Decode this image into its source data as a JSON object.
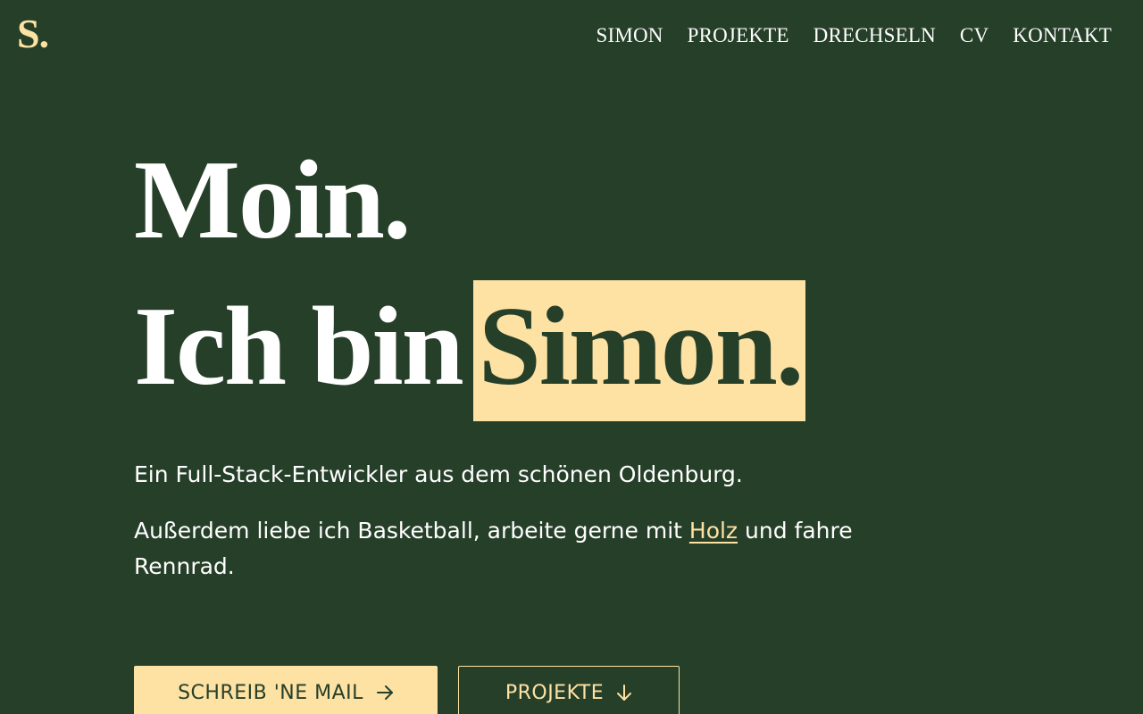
{
  "logo": "S.",
  "nav": {
    "items": [
      "SIMON",
      "PROJEKTE",
      "DRECHSELN",
      "CV",
      "KONTAKT"
    ]
  },
  "hero": {
    "greeting": "Moin.",
    "intro_prefix": "Ich bin",
    "name": "Simon.",
    "lead": "Ein Full-Stack-Entwickler aus dem schönen Oldenburg.",
    "sub_before": "Außerdem liebe ich Basketball, arbeite gerne mit ",
    "sub_link": "Holz",
    "sub_after": " und fahre Rennrad."
  },
  "buttons": {
    "mail_label": "SCHREIB 'NE MAIL",
    "mail_icon": "arrow-right-icon",
    "projects_label": "PROJEKTE",
    "projects_icon": "arrow-down-icon"
  },
  "colors": {
    "background": "#263f29",
    "accent": "#fde2a4",
    "text": "#ffffff"
  }
}
